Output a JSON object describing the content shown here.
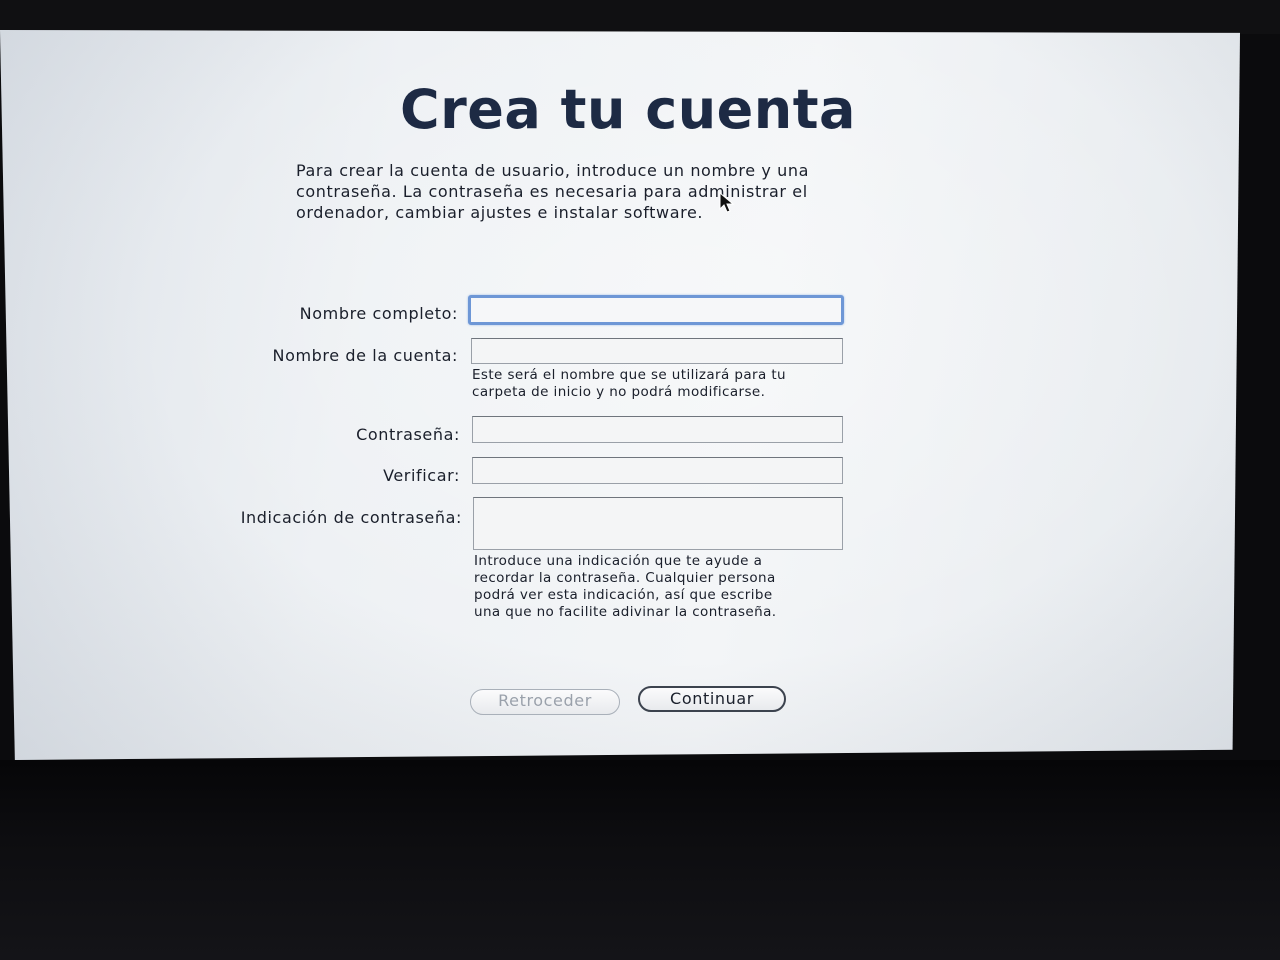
{
  "setup": {
    "title": "Crea tu cuenta",
    "intro_lines": [
      "Para crear la cuenta de usuario, introduce un nombre y una",
      "contraseña. La contraseña es necesaria para administrar el",
      "ordenador, cambiar ajustes e instalar software."
    ],
    "fields": {
      "full_name": {
        "label": "Nombre completo:",
        "value": ""
      },
      "account_name": {
        "label": "Nombre de la cuenta:",
        "value": "",
        "help_lines": [
          "Este será el nombre que se utilizará para tu",
          "carpeta de inicio y no podrá modificarse."
        ]
      },
      "password": {
        "label": "Contraseña:",
        "value": ""
      },
      "verify": {
        "label": "Verificar:",
        "value": ""
      },
      "hint": {
        "label": "Indicación de contraseña:",
        "value": "",
        "help_lines": [
          "Introduce una indicación que te ayude a",
          "recordar la contraseña. Cualquier persona",
          "podrá ver esta indicación, así que escribe",
          "una que no facilite adivinar la contraseña."
        ]
      }
    },
    "buttons": {
      "back": "Retroceder",
      "continue": "Continuar"
    }
  },
  "colors": {
    "title": "#1d2a44",
    "focus_ring": "#6e97d6",
    "disabled_text": "#9aa1ab"
  }
}
